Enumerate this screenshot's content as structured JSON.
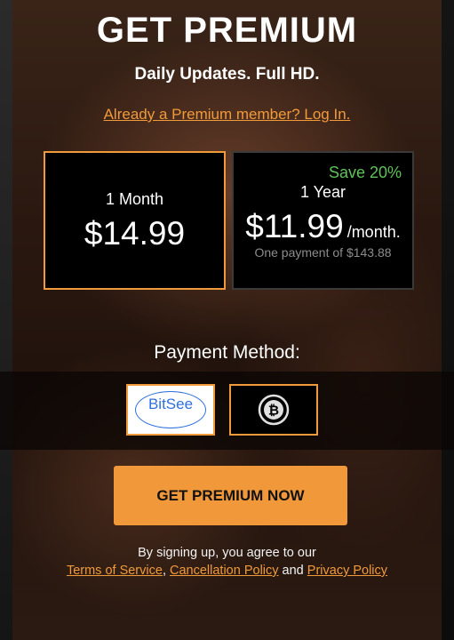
{
  "header": {
    "title": "GET PREMIUM",
    "subtitle": "Daily Updates. Full HD.",
    "login_link": "Already a Premium member? Log In."
  },
  "plans": {
    "month": {
      "name": "1 Month",
      "price": "$14.99"
    },
    "year": {
      "badge": "Save 20%",
      "name": "1 Year",
      "price": "$11.99",
      "per": "/month.",
      "note": "One payment of $143.88"
    }
  },
  "payment": {
    "label": "Payment Method:",
    "options": [
      {
        "label": "BitSee",
        "icon": "bitsee-logo"
      },
      {
        "label": "",
        "icon": "bitcoin-icon"
      }
    ]
  },
  "cta": {
    "label": "GET PREMIUM NOW"
  },
  "legal": {
    "prefix": "By signing up, you agree to our",
    "terms": "Terms of Service",
    "comma": ",",
    "cancellation": "Cancellation Policy",
    "and": "and",
    "privacy": "Privacy Policy"
  },
  "colors": {
    "accent": "#f1993a",
    "save_green": "#5fc25a",
    "bitsee_blue": "#2f6fe0"
  }
}
